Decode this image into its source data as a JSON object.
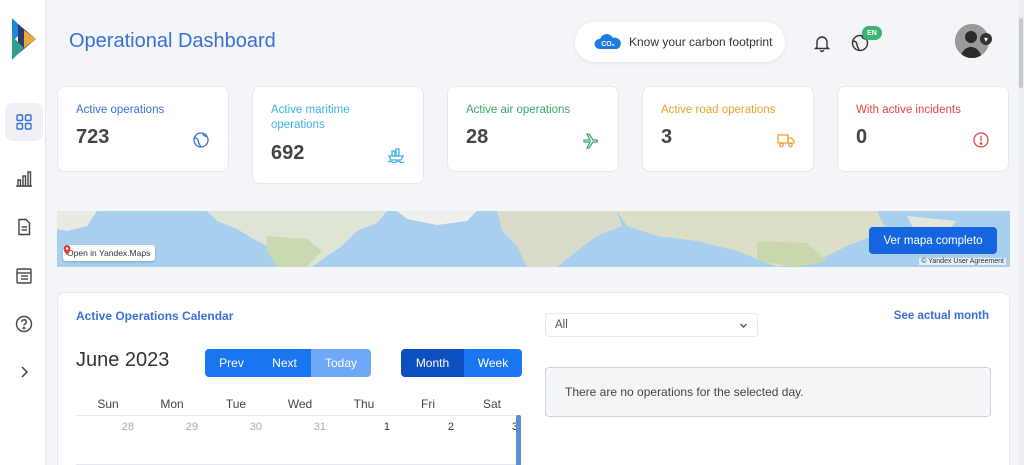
{
  "header": {
    "title": "Operational Dashboard",
    "carbon_label": "Know your carbon footprint",
    "co2_label": "CO₂",
    "lang_badge": "EN"
  },
  "sidebar": {
    "items": [
      {
        "icon": "dashboard-grid-icon",
        "active": true
      },
      {
        "icon": "bar-chart-icon",
        "active": false
      },
      {
        "icon": "document-icon",
        "active": false
      },
      {
        "icon": "list-table-icon",
        "active": false
      },
      {
        "icon": "help-circle-icon",
        "active": false
      },
      {
        "icon": "chevron-right-icon",
        "active": false
      }
    ]
  },
  "stats": [
    {
      "label": "Active operations",
      "value": "723",
      "color": "#3b6fd8",
      "icon": "globe-icon"
    },
    {
      "label": "Active maritime operations",
      "value": "692",
      "color": "#3fb0e8",
      "icon": "ship-icon"
    },
    {
      "label": "Active air operations",
      "value": "28",
      "color": "#3aa86b",
      "icon": "plane-icon"
    },
    {
      "label": "Active road operations",
      "value": "3",
      "color": "#f0a02c",
      "icon": "truck-icon"
    },
    {
      "label": "With active incidents",
      "value": "0",
      "color": "#e54545",
      "icon": "alert-icon"
    }
  ],
  "map": {
    "open_link": "Open in Yandex.Maps",
    "full_map_button": "Ver mapa completo",
    "copyright": "© Yandex  User Agreement"
  },
  "calendar": {
    "panel_title": "Active Operations Calendar",
    "month_title": "June 2023",
    "nav": {
      "prev": "Prev",
      "next": "Next",
      "today": "Today"
    },
    "views": {
      "month": "Month",
      "week": "Week"
    },
    "weekdays": [
      "Sun",
      "Mon",
      "Tue",
      "Wed",
      "Thu",
      "Fri",
      "Sat"
    ],
    "first_row": [
      "28",
      "29",
      "30",
      "31",
      "1",
      "2",
      "3"
    ],
    "filter_value": "All",
    "see_actual_month": "See actual month",
    "empty_message": "There are no operations for the selected day."
  }
}
